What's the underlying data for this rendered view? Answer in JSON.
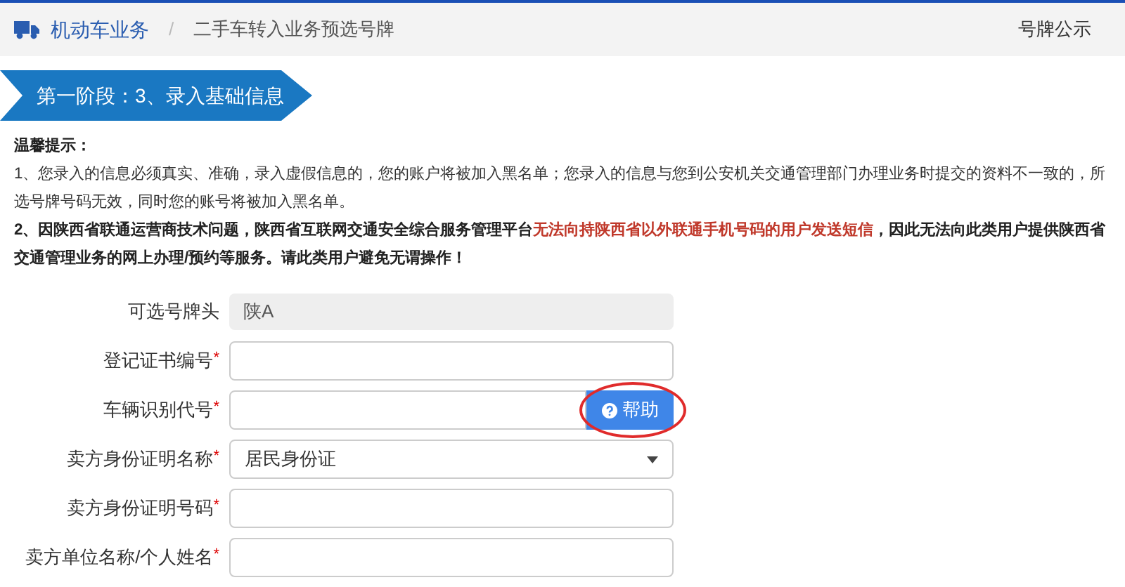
{
  "breadcrumb": {
    "section": "机动车业务",
    "separator": "/",
    "page": "二手车转入业务预选号牌",
    "link": "号牌公示"
  },
  "stage": "第一阶段：3、录入基础信息",
  "notice": {
    "title": "温馨提示：",
    "items": [
      [
        {
          "kind": "plain",
          "text": "1、您录入的信息必须真实、准确，录入虚假信息的，您的账户将被加入黑名单；您录入的信息与您到公安机关交通管理部门办理业务时提交的资料不一致的，所选号牌号码无效，同时您的账号将被加入黑名单。"
        }
      ],
      [
        {
          "kind": "bold",
          "text": "2、因陕西省联通运营商技术问题，陕西省互联网交通安全综合服务管理平台"
        },
        {
          "kind": "alert",
          "text": "无法向持陕西省以外联通手机号码的用户发送短信"
        },
        {
          "kind": "bold",
          "text": "，因此无法向此类用户提供陕西省交通管理业务的网上办理/预约等服务。请此类用户避免无谓操作！"
        }
      ]
    ]
  },
  "form": [
    {
      "label": "可选号牌头",
      "kind": "readonly",
      "value": "陕A"
    },
    {
      "label": "登记证书编号",
      "kind": "input",
      "marker": "*"
    },
    {
      "label": "车辆识别代号",
      "kind": "help",
      "marker": "*",
      "button": "帮助"
    },
    {
      "label": "卖方身份证明名称",
      "kind": "select",
      "marker": "*",
      "value": "居民身份证"
    },
    {
      "label": "卖方身份证明号码",
      "kind": "input",
      "marker": "*"
    },
    {
      "label": "卖方单位名称/个人姓名",
      "kind": "input",
      "marker": "*"
    }
  ]
}
